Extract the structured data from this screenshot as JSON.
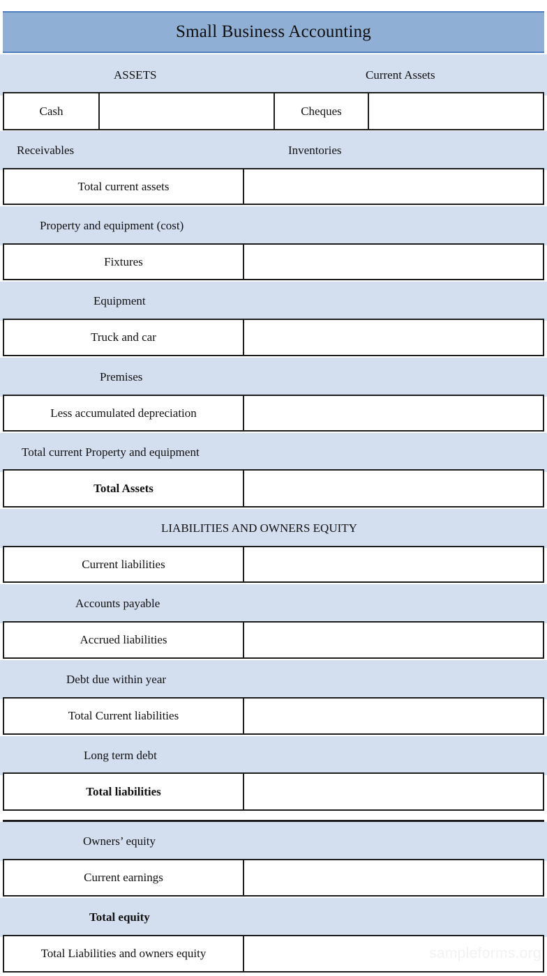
{
  "document": {
    "title": "Small Business Accounting",
    "watermark": "sampleforms.org"
  },
  "colors": {
    "title_bar": "#8FAFD4",
    "title_bar_border": "#4F7FBF",
    "band": "#D3DEEF",
    "entry_background": "#FFFFFF",
    "border": "#1C1C1C",
    "text": "#111111",
    "watermark": "#F2F2F2"
  },
  "sections": {
    "assets_heading_left": "ASSETS",
    "assets_heading_right": "Current Assets",
    "liabilities_heading": "LIABILITIES AND OWNERS EQUITY"
  },
  "rows": [
    {
      "kind": "band-two-col",
      "left_label": "ASSETS",
      "right_label": "Current Assets"
    },
    {
      "kind": "entry-four-col",
      "label_1": "Cash",
      "label_2": "Cheques",
      "value_1": "",
      "value_2": ""
    },
    {
      "kind": "band-two-col",
      "left_label": "Receivables",
      "right_label": "Inventories"
    },
    {
      "kind": "entry",
      "label": "Total current assets",
      "value": "",
      "bold": false
    },
    {
      "kind": "band",
      "label": "Property and equipment (cost)"
    },
    {
      "kind": "entry",
      "label": "Fixtures",
      "value": "",
      "bold": false
    },
    {
      "kind": "band",
      "label": "Equipment"
    },
    {
      "kind": "entry",
      "label": "Truck and car",
      "value": "",
      "bold": false
    },
    {
      "kind": "band",
      "label": "Premises"
    },
    {
      "kind": "entry",
      "label": "Less accumulated depreciation",
      "value": "",
      "bold": false
    },
    {
      "kind": "band",
      "label": "Total current Property and equipment"
    },
    {
      "kind": "entry",
      "label": "Total Assets",
      "value": "",
      "bold": true
    },
    {
      "kind": "band-center",
      "label": "LIABILITIES AND OWNERS EQUITY"
    },
    {
      "kind": "entry",
      "label": "Current liabilities",
      "value": "",
      "bold": false
    },
    {
      "kind": "band",
      "label": "Accounts payable"
    },
    {
      "kind": "entry",
      "label": "Accrued liabilities",
      "value": "",
      "bold": false
    },
    {
      "kind": "band",
      "label": "Debt due within year"
    },
    {
      "kind": "entry",
      "label": "Total Current liabilities",
      "value": "",
      "bold": false
    },
    {
      "kind": "band",
      "label": "Long term debt"
    },
    {
      "kind": "entry",
      "label": "Total liabilities",
      "value": "",
      "bold": true
    },
    {
      "kind": "rule"
    },
    {
      "kind": "band",
      "label": "Owners’ equity"
    },
    {
      "kind": "entry",
      "label": "Current earnings",
      "value": "",
      "bold": false
    },
    {
      "kind": "band",
      "label": "Total equity",
      "bold": true
    },
    {
      "kind": "entry",
      "label": "Total Liabilities and owners equity",
      "value": "",
      "bold": false
    }
  ]
}
